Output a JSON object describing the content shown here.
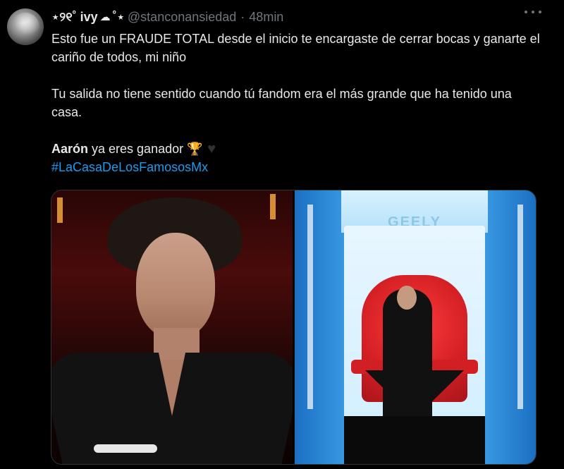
{
  "tweet": {
    "display_name": "⋆୨୧˚ ivy",
    "name_suffix": "˚⋆",
    "handle": "@stanconansiedad",
    "separator": "·",
    "time": "48min",
    "paragraph1": "Esto fue un FRAUDE TOTAL desde el inicio te encargaste de cerrar bocas y ganarte el cariño de todos, mi niño",
    "paragraph2": "Tu salida no tiene sentido cuando tú fandom era el más grande que ha tenido una casa.",
    "line3_name": "Aarón",
    "line3_text": " ya eres ganador ",
    "hashtag": "#LaCasaDeLosFamososMx",
    "icons": {
      "cloud": "☁",
      "trophy": "🏆",
      "heart": "♥"
    }
  },
  "media": {
    "right_sign": "GEELY"
  },
  "colors": {
    "background": "#000000",
    "text": "#e7e9ea",
    "muted": "#71767b",
    "link": "#1d9bf0"
  }
}
